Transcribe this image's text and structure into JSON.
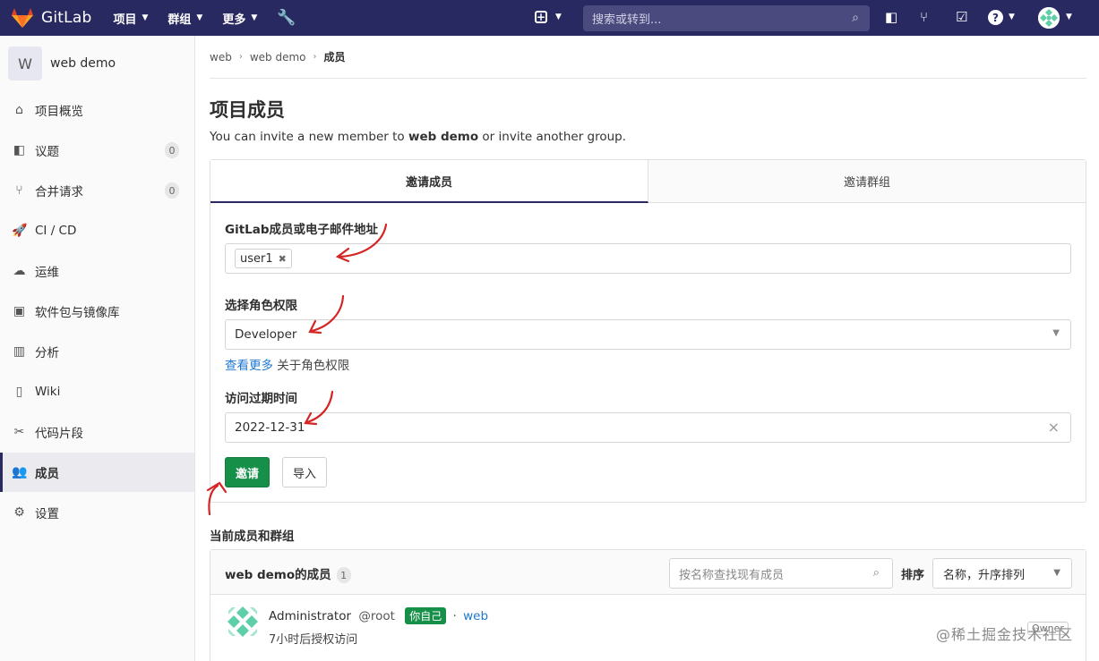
{
  "topnav": {
    "brand": "GitLab",
    "menus": [
      "项目",
      "群组",
      "更多"
    ],
    "search_placeholder": "搜索或转到..."
  },
  "sidebar": {
    "project_initial": "W",
    "project_name": "web demo",
    "items": [
      {
        "label": "项目概览",
        "icon": "home-icon"
      },
      {
        "label": "议题",
        "icon": "issues-icon",
        "count": "0"
      },
      {
        "label": "合并请求",
        "icon": "merge-request-icon",
        "count": "0"
      },
      {
        "label": "CI / CD",
        "icon": "rocket-icon"
      },
      {
        "label": "运维",
        "icon": "cloud-icon"
      },
      {
        "label": "软件包与镜像库",
        "icon": "package-icon"
      },
      {
        "label": "分析",
        "icon": "chart-icon"
      },
      {
        "label": "Wiki",
        "icon": "book-icon"
      },
      {
        "label": "代码片段",
        "icon": "scissors-icon"
      },
      {
        "label": "成员",
        "icon": "users-icon",
        "active": true
      },
      {
        "label": "设置",
        "icon": "gear-icon"
      }
    ]
  },
  "breadcrumb": [
    "web",
    "web demo",
    "成员"
  ],
  "page": {
    "title": "项目成员",
    "desc_prefix": "You can invite a new member to ",
    "desc_project": "web demo",
    "desc_suffix": " or invite another group."
  },
  "invite": {
    "tabs": [
      "邀请成员",
      "邀请群组"
    ],
    "member_label": "GitLab成员或电子邮件地址",
    "member_token": "user1",
    "role_label": "选择角色权限",
    "role_value": "Developer",
    "role_help_link": "查看更多",
    "role_help_text": " 关于角色权限",
    "expire_label": "访问过期时间",
    "expire_value": "2022-12-31",
    "invite_button": "邀请",
    "import_button": "导入"
  },
  "members": {
    "section_title": "当前成员和群组",
    "header_title": "web demo的成员",
    "count": "1",
    "search_placeholder": "按名称查找现有成员",
    "sort_label": "排序",
    "sort_value": "名称，升序排列",
    "rows": [
      {
        "name": "Administrator",
        "handle": "@root",
        "badge": "你自己",
        "separator": "·",
        "group": "web",
        "sub": "7小时后授权访问",
        "role": "Owner"
      }
    ]
  },
  "watermark": "@稀土掘金技术社区",
  "colors": {
    "nav_bg": "#292961",
    "primary_green": "#168f48",
    "link": "#1f78d1"
  }
}
